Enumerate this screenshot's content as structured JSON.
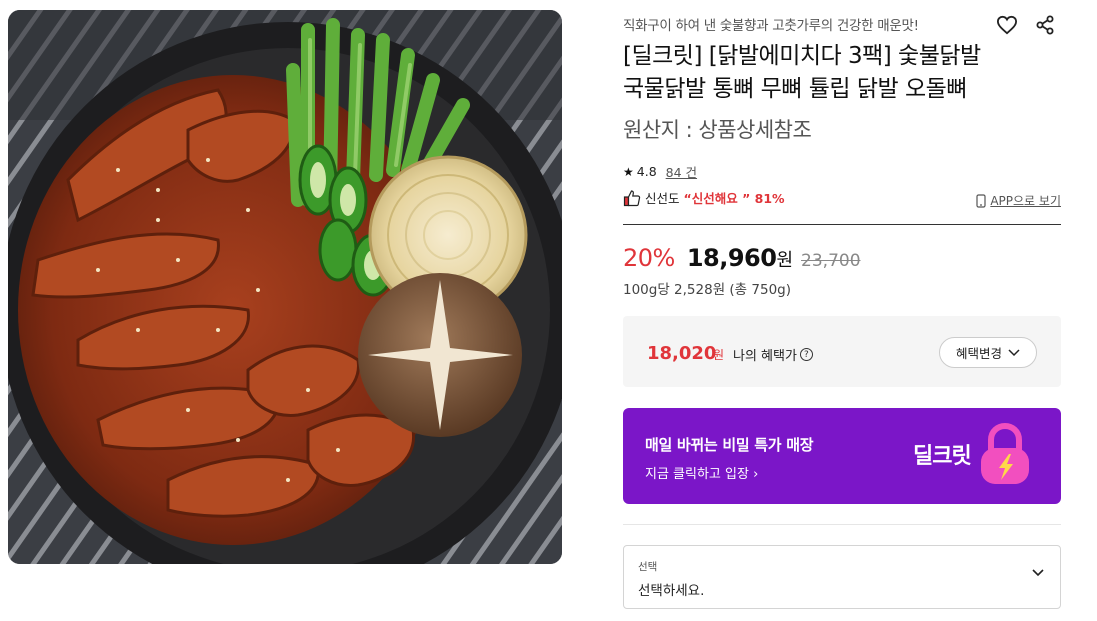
{
  "product": {
    "image_alt": "닭발 요리 이미지",
    "subtitle": "직화구이 하여 낸 숯불향과 고춧가루의 건강한 매운맛!",
    "title_line1": "[딜크릿] [닭발에미치다 3팩] 숯불닭발",
    "title_line2": "국물닭발 통뼈 무뼈 튤립 닭발 오돌뼈",
    "origin": "원산지 : 상품상세참조",
    "rating": "4.8",
    "review_count": "84 건",
    "freshness_label": "신선도",
    "freshness_value": "“신선해요 ” 81%",
    "app_view": "APP으로 보기"
  },
  "price": {
    "discount": "20%",
    "sale_price": "18,960",
    "won": "원",
    "original_price": "23,700",
    "unit_price": "100g당 2,528원 (총 750g)"
  },
  "benefit": {
    "price": "18,020",
    "won": "원",
    "label": "나의 혜택가",
    "help": "?",
    "change_button": "혜택변경"
  },
  "banner": {
    "title": "매일 바뀌는 비밀 특가 매장",
    "subtitle": "지금 클릭하고 입장 ›",
    "logo_text": "딜크릿"
  },
  "option_select": {
    "label": "선택",
    "value": "선택하세요."
  },
  "colors": {
    "accent_red": "#e0353a",
    "banner_purple": "#7b16c8",
    "lock_pink": "#f24fbf"
  },
  "icons": [
    "heart-icon",
    "share-icon",
    "star-icon",
    "thumbs-up-icon",
    "mobile-icon",
    "help-icon",
    "chevron-down-icon",
    "lock-icon"
  ]
}
